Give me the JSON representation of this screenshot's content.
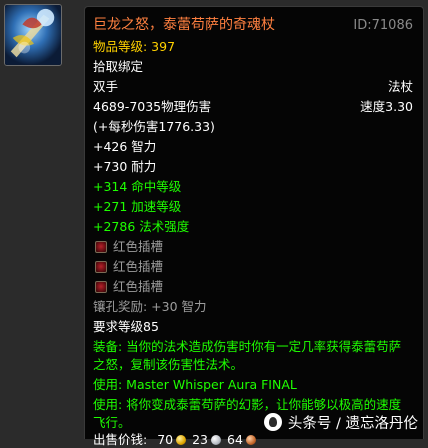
{
  "item": {
    "name": "巨龙之怒，泰蕾苟萨的奇魂杖",
    "id": "ID:71086",
    "item_level": "物品等级: 397",
    "binding": "拾取绑定",
    "hand": "双手",
    "type": "法杖",
    "damage": "4689-7035物理伤害",
    "speed": "速度3.30",
    "dps": "(+每秒伤害1776.33)",
    "stats": [
      "+426 智力",
      "+730 耐力"
    ],
    "green_stats": [
      "+314 命中等级",
      "+271 加速等级",
      "+2786 法术强度"
    ],
    "sockets": [
      "红色插槽",
      "红色插槽",
      "红色插槽"
    ],
    "socket_bonus": "镶孔奖励: +30 智力",
    "required_level": "要求等级85",
    "equip_line1": "装备: 当你的法术造成伤害时你有一定几率获得泰蕾苟萨",
    "equip_line2": "之怒，复制该伤害性法术。",
    "use1": "使用: Master Whisper Aura FINAL",
    "use2_line1": "使用: 将你变成泰蕾苟萨的幻影，让你能够以极高的速度",
    "use2_line2": "飞行。",
    "sell_label": "出售价钱:",
    "gold": "70",
    "silver": "23",
    "copper": "64"
  },
  "icons": {
    "item_icon": "staff-item-icon",
    "socket_icon": "red-socket-icon",
    "gold": "gold-coin-icon",
    "silver": "silver-coin-icon",
    "copper": "copper-coin-icon"
  },
  "colors": {
    "legendary_orange": "#ff8040",
    "item_level_yellow": "#ffd100",
    "bonus_green": "#1eff00",
    "disabled_gray": "#9d9d9d"
  },
  "watermark": {
    "text": "头条号 / 遗忘洛丹伦"
  }
}
